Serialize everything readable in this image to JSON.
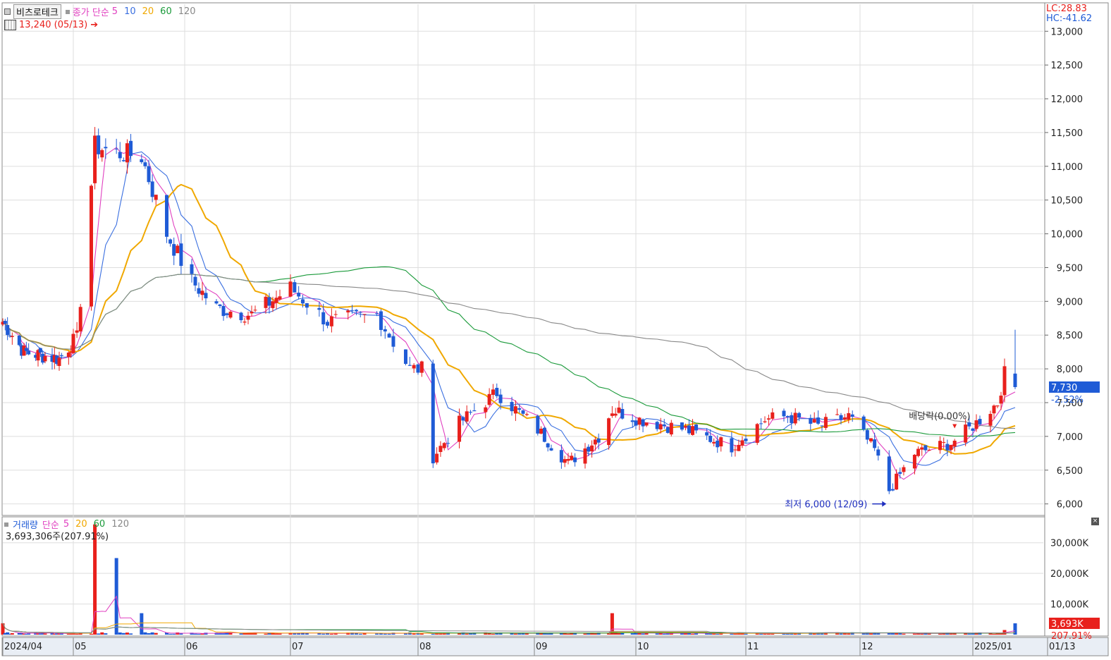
{
  "chart_data": [
    {
      "type": "candlestick",
      "stock_name": "비츠로테크",
      "legend": {
        "label": "종가 단순",
        "ma": [
          {
            "period": "5",
            "color": "#e040c0"
          },
          {
            "period": "10",
            "color": "#3a6fe0"
          },
          {
            "period": "20",
            "color": "#f0a800"
          },
          {
            "period": "60",
            "color": "#1a9a3a"
          },
          {
            "period": "120",
            "color": "#888888"
          }
        ]
      },
      "indicators": {
        "lc": "LC:28.83",
        "hc": "HC:-41.62"
      },
      "high_marker": "13,240 (05/13)",
      "low_marker": "최저 6,000 (12/09)",
      "event_marker": "배당락(0.00%)",
      "current_price": {
        "value": "7,730",
        "change": "-2.52%"
      },
      "x_labels": [
        "2024/04",
        "05",
        "06",
        "07",
        "08",
        "09",
        "10",
        "11",
        "12",
        "2025/01",
        "01/13"
      ],
      "y_ticks": [
        6000,
        6500,
        7000,
        7500,
        8000,
        8500,
        9000,
        9500,
        10000,
        10500,
        11000,
        11500,
        12000,
        12500,
        13000
      ],
      "y_tick_labels": [
        "6,000",
        "6,500",
        "7,000",
        "7,500",
        "8,000",
        "8,500",
        "9,000",
        "9,500",
        "10,000",
        "10,500",
        "11,000",
        "11,500",
        "12,000",
        "12,500",
        "13,000"
      ],
      "y_range": [
        5850,
        13400
      ],
      "up_color": "#e8201c",
      "down_color": "#1f5bd6",
      "key_closes": [
        {
          "date": "2024-04-01",
          "close": 8700
        },
        {
          "date": "2024-04-10",
          "close": 8250
        },
        {
          "date": "2024-04-25",
          "close": 8150
        },
        {
          "date": "2024-05-02",
          "close": 8450
        },
        {
          "date": "2024-05-07",
          "close": 11300
        },
        {
          "date": "2024-05-13",
          "close": 11200
        },
        {
          "date": "2024-05-20",
          "close": 11150
        },
        {
          "date": "2024-05-27",
          "close": 10000
        },
        {
          "date": "2024-06-03",
          "close": 9300
        },
        {
          "date": "2024-06-10",
          "close": 8900
        },
        {
          "date": "2024-06-20",
          "close": 8800
        },
        {
          "date": "2024-07-01",
          "close": 9200
        },
        {
          "date": "2024-07-10",
          "close": 8700
        },
        {
          "date": "2024-07-22",
          "close": 8800
        },
        {
          "date": "2024-07-30",
          "close": 8000
        },
        {
          "date": "2024-08-02",
          "close": 8000
        },
        {
          "date": "2024-08-05",
          "close": 6700
        },
        {
          "date": "2024-08-12",
          "close": 7200
        },
        {
          "date": "2024-08-22",
          "close": 7650
        },
        {
          "date": "2024-09-02",
          "close": 7100
        },
        {
          "date": "2024-09-11",
          "close": 6600
        },
        {
          "date": "2024-09-20",
          "close": 7000
        },
        {
          "date": "2024-09-24",
          "close": 7400
        },
        {
          "date": "2024-10-02",
          "close": 7250
        },
        {
          "date": "2024-10-15",
          "close": 7100
        },
        {
          "date": "2024-10-28",
          "close": 6850
        },
        {
          "date": "2024-11-06",
          "close": 7250
        },
        {
          "date": "2024-11-12",
          "close": 7300
        },
        {
          "date": "2024-11-20",
          "close": 7150
        },
        {
          "date": "2024-11-28",
          "close": 7300
        },
        {
          "date": "2024-12-05",
          "close": 6800
        },
        {
          "date": "2024-12-09",
          "close": 6200
        },
        {
          "date": "2024-12-16",
          "close": 6750
        },
        {
          "date": "2024-12-26",
          "close": 6900
        },
        {
          "date": "2025-01-02",
          "close": 7200
        },
        {
          "date": "2025-01-08",
          "close": 7500
        },
        {
          "date": "2025-01-10",
          "close": 7930
        },
        {
          "date": "2025-01-13",
          "close": 7730
        }
      ]
    },
    {
      "type": "bar",
      "title": "거래량",
      "legend": {
        "label": "단순",
        "ma": [
          {
            "period": "5",
            "color": "#e040c0"
          },
          {
            "period": "20",
            "color": "#f0a800"
          },
          {
            "period": "60",
            "color": "#1a9a3a"
          },
          {
            "period": "120",
            "color": "#888888"
          }
        ]
      },
      "info": "3,693,306주(207.91%)",
      "current_value": {
        "value": "3,693K",
        "ratio": "207.91%"
      },
      "y_ticks": [
        10000,
        20000,
        30000
      ],
      "y_tick_labels": [
        "10,000K",
        "20,000K",
        "30,000K"
      ],
      "y_range": [
        0,
        38000
      ],
      "spikes": [
        {
          "date": "2024-04-01",
          "volume_k": 3700
        },
        {
          "date": "2024-05-07",
          "volume_k": 36000
        },
        {
          "date": "2024-05-13",
          "volume_k": 25000
        },
        {
          "date": "2024-05-20",
          "volume_k": 7000
        },
        {
          "date": "2024-09-24",
          "volume_k": 7000
        },
        {
          "date": "2025-01-10",
          "volume_k": 1500
        },
        {
          "date": "2025-01-13",
          "volume_k": 3693
        }
      ]
    }
  ]
}
